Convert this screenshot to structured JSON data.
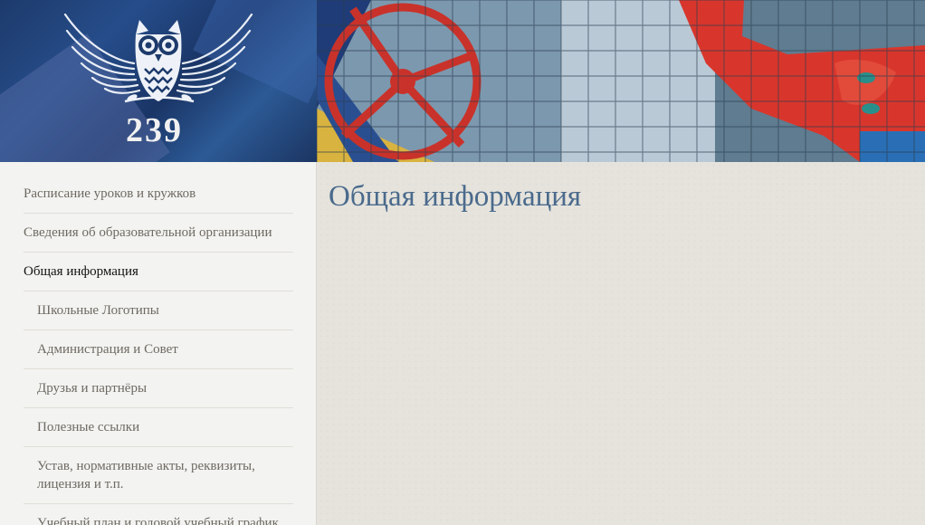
{
  "header": {
    "school_number": "239"
  },
  "sidebar": {
    "items": [
      {
        "label": "Расписание уроков и кружков",
        "level": 0,
        "active": false
      },
      {
        "label": "Сведения об образовательной организации",
        "level": 0,
        "active": false
      },
      {
        "label": "Общая информация",
        "level": 0,
        "active": true
      },
      {
        "label": "Школьные Логотипы",
        "level": 1,
        "active": false
      },
      {
        "label": "Администрация и Совет",
        "level": 1,
        "active": false
      },
      {
        "label": "Друзья и партнёры",
        "level": 1,
        "active": false
      },
      {
        "label": "Полезные ссылки",
        "level": 1,
        "active": false
      },
      {
        "label": "Устав, нормативные акты, реквизиты, лицензия и т.п.",
        "level": 1,
        "active": false
      },
      {
        "label": "Учебный план и годовой учебный график",
        "level": 1,
        "active": false
      }
    ]
  },
  "main": {
    "title": "Общая информация"
  },
  "colors": {
    "title": "#4a6a8c",
    "nav_text": "#6e6a62",
    "nav_active": "#111111",
    "logo_bg": "#1d3a6b"
  }
}
